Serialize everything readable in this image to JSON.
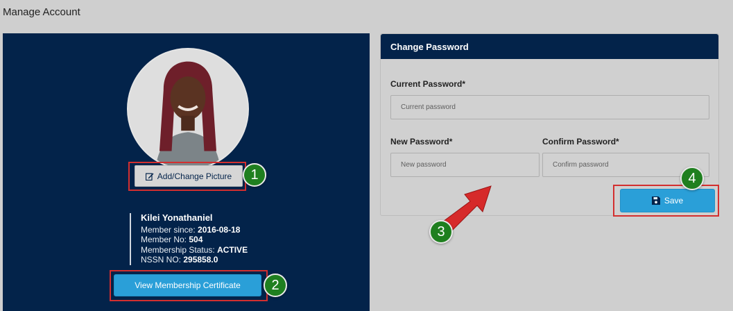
{
  "page": {
    "title": "Manage Account"
  },
  "profile": {
    "change_picture_label": "Add/Change Picture",
    "name": "Kilei Yonathaniel",
    "member_since_label": "Member since:",
    "member_since": "2016-08-18",
    "member_no_label": "Member No:",
    "member_no": "504",
    "status_label": "Membership Status:",
    "status": "ACTIVE",
    "nssn_label": "NSSN NO:",
    "nssn": "295858.0",
    "certificate_label": "View Membership Certificate"
  },
  "password": {
    "title": "Change Password",
    "current_label": "Current Password*",
    "current_placeholder": "Current password",
    "new_label": "New Password*",
    "new_placeholder": "New password",
    "confirm_label": "Confirm Password*",
    "confirm_placeholder": "Confirm password",
    "save_label": "Save"
  },
  "annotations": [
    "1",
    "2",
    "3",
    "4"
  ],
  "colors": {
    "navy": "#03234a",
    "button_blue": "#2a9fd8",
    "highlight_red": "#d32f2f",
    "badge_green": "#1f7f1f"
  },
  "icons": [
    "edit-icon",
    "floppy-disk-icon",
    "red-arrow-icon"
  ]
}
